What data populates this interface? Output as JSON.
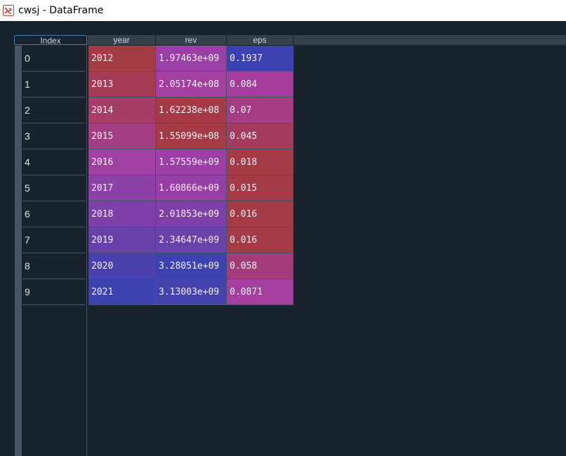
{
  "window": {
    "title": "cwsj - DataFrame",
    "icon": "dataframe-app-icon"
  },
  "table": {
    "index_header": "Index",
    "columns": [
      "year",
      "rev",
      "eps"
    ],
    "index": [
      "0",
      "1",
      "2",
      "3",
      "4",
      "5",
      "6",
      "7",
      "8",
      "9"
    ],
    "rows": [
      [
        "2012",
        "1.97463e+09",
        "0.1937"
      ],
      [
        "2013",
        "2.05174e+08",
        "0.084"
      ],
      [
        "2014",
        "1.62238e+08",
        "0.07"
      ],
      [
        "2015",
        "1.55099e+08",
        "0.045"
      ],
      [
        "2016",
        "1.57559e+09",
        "0.018"
      ],
      [
        "2017",
        "1.60866e+09",
        "0.015"
      ],
      [
        "2018",
        "2.01853e+09",
        "0.016"
      ],
      [
        "2019",
        "2.34647e+09",
        "0.016"
      ],
      [
        "2020",
        "3.28051e+09",
        "0.058"
      ],
      [
        "2021",
        "3.13003e+09",
        "0.0871"
      ]
    ],
    "cell_colors": [
      [
        "#a43c46",
        "#9b3fa8",
        "#3b41b0"
      ],
      [
        "#a53b55",
        "#a33f9f",
        "#a43c9c"
      ],
      [
        "#a53d67",
        "#a43a45",
        "#a53c84"
      ],
      [
        "#a43f83",
        "#a43a44",
        "#a53c5f"
      ],
      [
        "#a040a3",
        "#9b3fa7",
        "#a43b46"
      ],
      [
        "#8d40a7",
        "#983ea7",
        "#a43a45"
      ],
      [
        "#7c40a8",
        "#7e3fa9",
        "#a43a45"
      ],
      [
        "#6840a9",
        "#6a40aa",
        "#a43a45"
      ],
      [
        "#4a41ac",
        "#3c42b0",
        "#a43c7a"
      ],
      [
        "#3c42b0",
        "#4541ad",
        "#a43fa0"
      ]
    ]
  }
}
